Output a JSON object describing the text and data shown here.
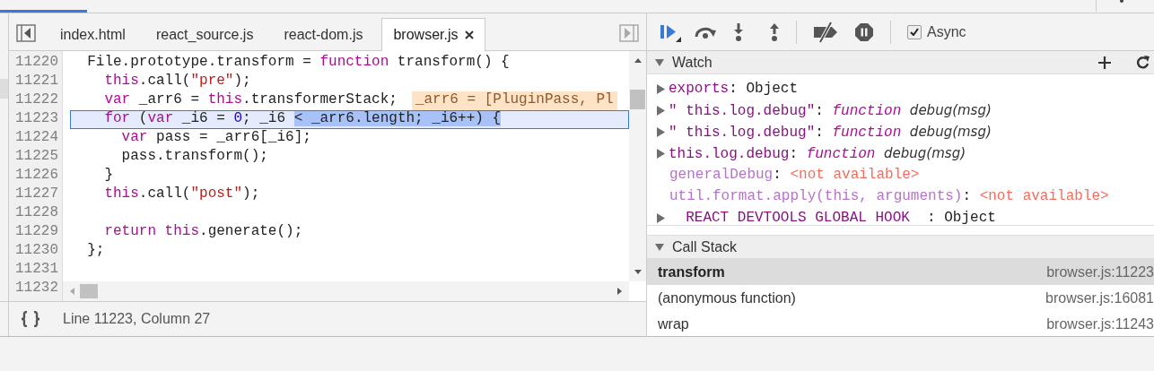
{
  "file_tabs": [
    {
      "label": "index.html",
      "selected": false
    },
    {
      "label": "react_source.js",
      "selected": false
    },
    {
      "label": "react-dom.js",
      "selected": false
    },
    {
      "label": "browser.js",
      "selected": true
    }
  ],
  "editor": {
    "lines": [
      {
        "number": "11220",
        "selected": false,
        "tokens": [
          {
            "kind": "plain",
            "text": "  File.prototype.transform = "
          },
          {
            "kind": "keyword",
            "text": "function"
          },
          {
            "kind": "plain",
            "text": " transform() {"
          }
        ]
      },
      {
        "number": "11221",
        "selected": false,
        "tokens": [
          {
            "kind": "keyword",
            "text": "    this"
          },
          {
            "kind": "plain",
            "text": ".call("
          },
          {
            "kind": "string",
            "text": "\"pre\""
          },
          {
            "kind": "plain",
            "text": ");"
          }
        ]
      },
      {
        "number": "11222",
        "selected": false,
        "tokens": [
          {
            "kind": "keyword",
            "text": "    var"
          },
          {
            "kind": "plain",
            "text": " _arr6 = "
          },
          {
            "kind": "keyword",
            "text": "this"
          },
          {
            "kind": "plain",
            "text": ".transformerStack;"
          }
        ],
        "inline_value": "_arr6 = [PluginPass, Pl"
      },
      {
        "number": "11223",
        "selected": true,
        "tokens": [
          {
            "kind": "keyword",
            "text": "    for"
          },
          {
            "kind": "plain",
            "text": " ("
          },
          {
            "kind": "keyword",
            "text": "var"
          },
          {
            "kind": "plain",
            "text": " _i6 = "
          },
          {
            "kind": "number",
            "text": "0"
          },
          {
            "kind": "plain",
            "text": "; _i6 "
          },
          {
            "kind": "evaluated",
            "text": "< _arr6.length; _i6++) {"
          }
        ]
      },
      {
        "number": "11224",
        "selected": false,
        "tokens": [
          {
            "kind": "keyword",
            "text": "      var"
          },
          {
            "kind": "plain",
            "text": " pass = _arr6[_i6];"
          }
        ]
      },
      {
        "number": "11225",
        "selected": false,
        "tokens": [
          {
            "kind": "plain",
            "text": "      pass.transform();"
          }
        ]
      },
      {
        "number": "11226",
        "selected": false,
        "tokens": [
          {
            "kind": "plain",
            "text": "    }"
          }
        ]
      },
      {
        "number": "11227",
        "selected": false,
        "tokens": [
          {
            "kind": "keyword",
            "text": "    this"
          },
          {
            "kind": "plain",
            "text": ".call("
          },
          {
            "kind": "string",
            "text": "\"post\""
          },
          {
            "kind": "plain",
            "text": ");"
          }
        ]
      },
      {
        "number": "11228",
        "selected": false
      },
      {
        "number": "11229",
        "selected": false,
        "tokens": [
          {
            "kind": "keyword",
            "text": "    return"
          },
          {
            "kind": "keyword",
            "text": " this"
          },
          {
            "kind": "plain",
            "text": ".generate();"
          }
        ]
      },
      {
        "number": "11230",
        "selected": false,
        "tokens": [
          {
            "kind": "plain",
            "text": "  };"
          }
        ]
      },
      {
        "number": "11231",
        "selected": false
      },
      {
        "number": "11232"
      }
    ]
  },
  "status_bar": {
    "position": "Line 11223, Column 27"
  },
  "debugger_toolbar": {
    "async": {
      "label": "Async",
      "checked": true
    }
  },
  "watch": {
    "title": "Watch",
    "expanded": true,
    "items": [
      {
        "expandable": true,
        "available": true,
        "name": "exports",
        "separator": ":",
        "value": "Object"
      },
      {
        "expandable": true,
        "available": true,
        "name": "\" this.log.debug\"",
        "separator": ":",
        "keyword": "function",
        "value": "debug(msg)"
      },
      {
        "expandable": true,
        "available": true,
        "name": "\" this.log.debug\"",
        "separator": ":",
        "keyword": "function",
        "value": "debug(msg)"
      },
      {
        "expandable": true,
        "available": true,
        "name": "this.log.debug",
        "separator": ":",
        "keyword": "function",
        "value": "debug(msg)"
      },
      {
        "expandable": false,
        "available": false,
        "name": "generalDebug",
        "separator": ":",
        "value": "<not available>"
      },
      {
        "expandable": false,
        "available": false,
        "name": "util.format.apply(this, arguments)",
        "separator": ":",
        "value": "<not available>"
      },
      {
        "expandable": true,
        "available": true,
        "name": "  REACT DEVTOOLS GLOBAL HOOK  ",
        "separator": ":",
        "value": "Object"
      }
    ]
  },
  "call_stack": {
    "title": "Call Stack",
    "expanded": true,
    "frames": [
      {
        "name": "transform",
        "location": "browser.js:11223",
        "selected": true
      },
      {
        "name": "(anonymous function)",
        "location": "browser.js:16081",
        "selected": false
      },
      {
        "name": "wrap",
        "location": "browser.js:11243",
        "selected": false
      }
    ]
  }
}
